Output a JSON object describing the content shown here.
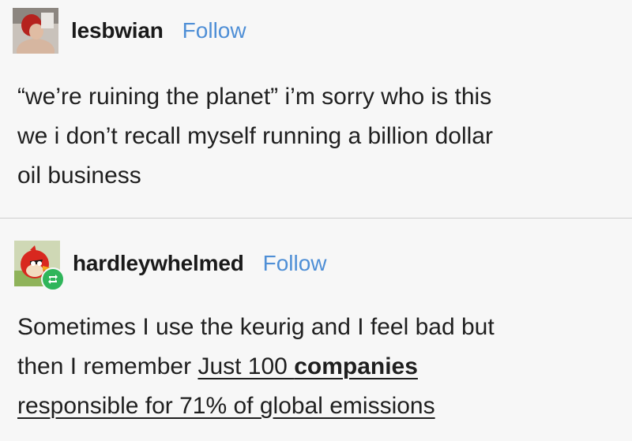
{
  "posts": [
    {
      "username": "lesbwian",
      "follow_label": "Follow",
      "avatar_icon": "user-photo-avatar",
      "lines": [
        "“we’re ruining the planet” i’m sorry who is this",
        "we i don’t recall myself running a billion dollar",
        "oil business"
      ]
    },
    {
      "username": "hardleywhelmed",
      "follow_label": "Follow",
      "avatar_icon": "angry-bird-avatar",
      "badge_icon": "reblog-icon",
      "line1": "Sometimes I use the keurig and I feel bad but",
      "line2_prefix": "then I remember ",
      "link_part1": "Just 100 ",
      "link_bold": "companies",
      "link_part2": "responsible for 71% of global emissions"
    }
  ],
  "colors": {
    "background": "#f7f7f7",
    "follow": "#4f8fd6",
    "text": "#1f1f1f",
    "badge": "#2fb55a"
  }
}
